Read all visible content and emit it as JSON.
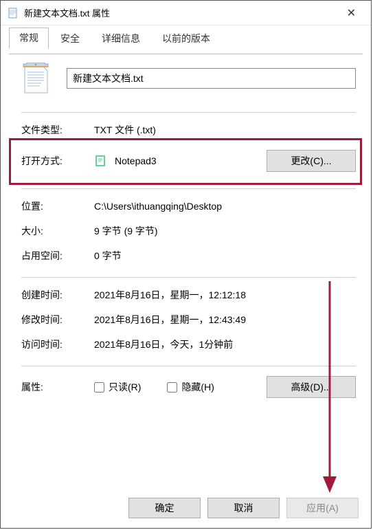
{
  "titlebar": {
    "title": "新建文本文档.txt 属性"
  },
  "tabs": {
    "general": "常规",
    "security": "安全",
    "details": "详细信息",
    "previous": "以前的版本"
  },
  "file": {
    "name": "新建文本文档.txt"
  },
  "labels": {
    "filetype": "文件类型:",
    "openwith": "打开方式:",
    "location": "位置:",
    "size": "大小:",
    "sizeondisk": "占用空间:",
    "created": "创建时间:",
    "modified": "修改时间:",
    "accessed": "访问时间:",
    "attributes": "属性:"
  },
  "values": {
    "filetype": "TXT 文件 (.txt)",
    "openwith_app": "Notepad3",
    "location": "C:\\Users\\ithuangqing\\Desktop",
    "size": "9 字节 (9 字节)",
    "sizeondisk": "0 字节",
    "created": "2021年8月16日，星期一，12:12:18",
    "modified": "2021年8月16日，星期一，12:43:49",
    "accessed": "2021年8月16日，今天，1分钟前"
  },
  "buttons": {
    "change": "更改(C)...",
    "advanced": "高级(D)...",
    "ok": "确定",
    "cancel": "取消",
    "apply": "应用(A)"
  },
  "checkboxes": {
    "readonly": "只读(R)",
    "hidden": "隐藏(H)"
  },
  "colors": {
    "highlight": "#9e1c3a"
  }
}
